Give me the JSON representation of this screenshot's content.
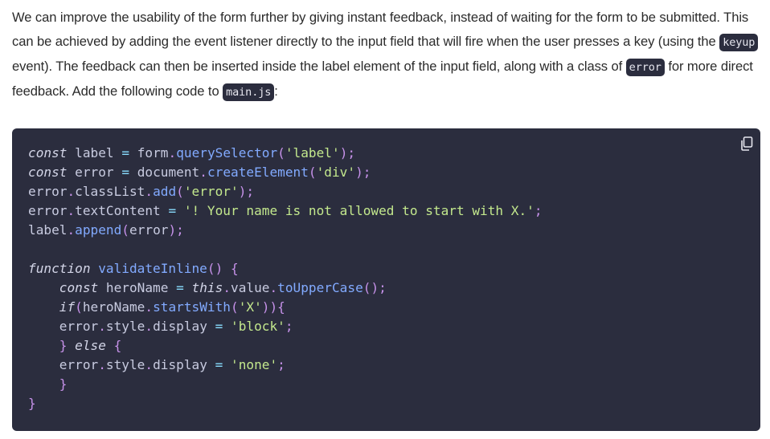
{
  "prose": {
    "p1_a": "We can improve the usability of the form further by giving instant feedback, instead of waiting for the form to be submitted. This can be achieved by adding the event listener directly to the input field that will fire when the user presses a key (using the ",
    "code_keyup": "keyup",
    "p1_b": " event). The feedback can then be inserted inside the label element of the input field, along with a class of ",
    "code_error": "error",
    "p1_c": " for more direct feedback. Add the following code to ",
    "code_mainjs": "main.js",
    "p1_d": ":"
  },
  "code_block": {
    "copy_icon": "copy-icon",
    "lines": [
      "const label = form.querySelector('label');",
      "const error = document.createElement('div');",
      "error.classList.add('error');",
      "error.textContent = '! Your name is not allowed to start with X.';",
      "label.append(error);",
      "",
      "function validateInline() {",
      "    const heroName = this.value.toUpperCase();",
      "    if(heroName.startsWith('X')){",
      "    error.style.display = 'block';",
      "    } else {",
      "    error.style.display = 'none';",
      "    }",
      "}"
    ]
  },
  "colors": {
    "code_background": "#2b2d3e",
    "keyword": "#d4d6e8",
    "function": "#82aaff",
    "string": "#c3e88d",
    "punctuation": "#c792ea"
  }
}
